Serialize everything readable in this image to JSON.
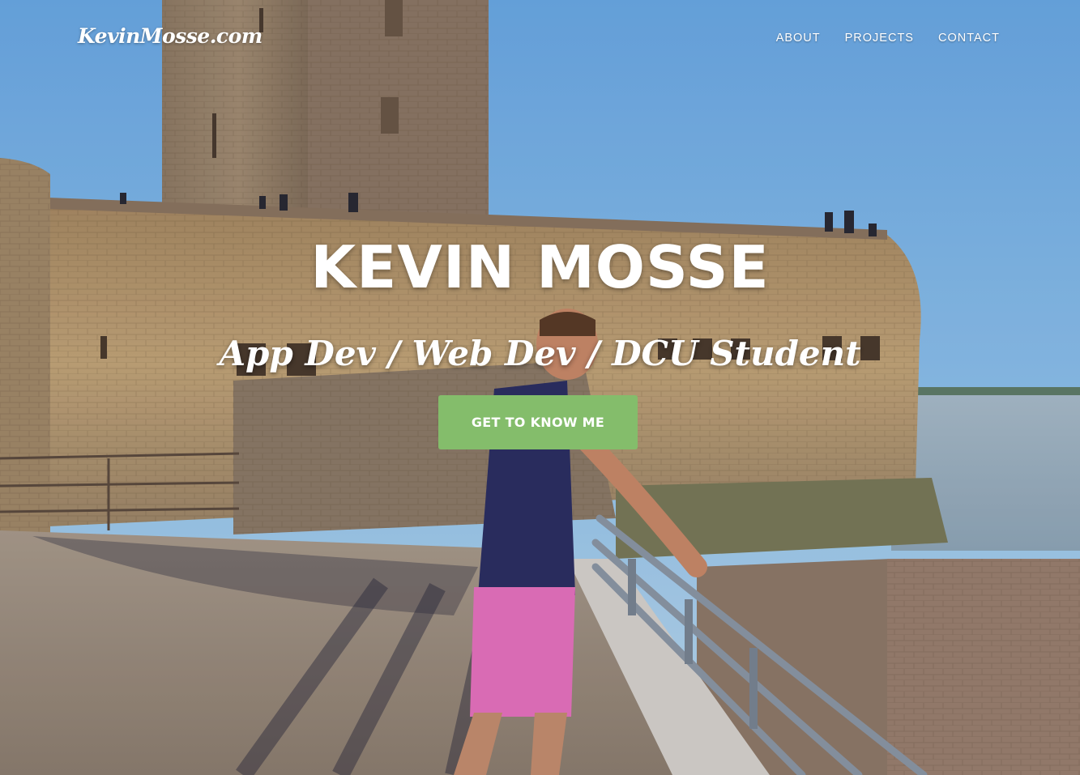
{
  "brand": {
    "name": "KevinMosse.com"
  },
  "nav": {
    "items": [
      {
        "label": "ABOUT"
      },
      {
        "label": "PROJECTS"
      },
      {
        "label": "CONTACT"
      }
    ]
  },
  "hero": {
    "title": "KEVIN MOSSE",
    "subtitle": "App Dev / Web Dev / DCU Student",
    "cta_label": "GET TO KNOW ME",
    "background_image": "photo-fortress-by-sea-icon"
  },
  "colors": {
    "cta": "#84bd6b",
    "text": "#ffffff",
    "sky": "#7fb6e8",
    "stone": "#b79a6f",
    "sea": "#9fb3c4"
  }
}
